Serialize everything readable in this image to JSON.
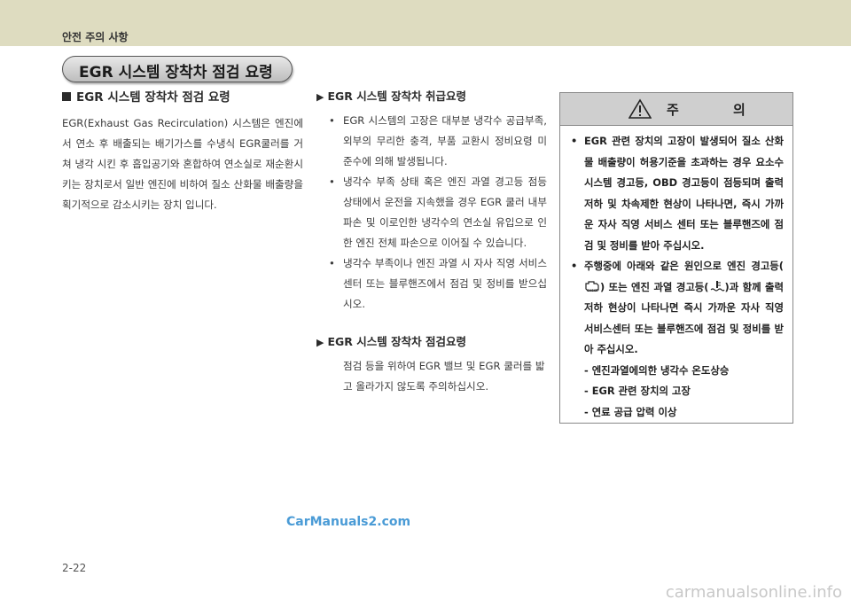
{
  "header": {
    "title": "안전 주의 사항"
  },
  "section_pill": "EGR 시스템 장착차 점검 요령",
  "col1": {
    "heading": "EGR 시스템 장착차 점검 요령",
    "body": "EGR(Exhaust Gas Recirculation) 시스템은 엔진에서 연소 후 배출되는 배기가스를 수냉식 EGR쿨러를 거쳐 냉각 시킨 후 흡입공기와 혼합하여 연소실로 재순환시키는 장치로서 일반 엔진에 비하여 질소 산화물 배출량을 획기적으로 감소시키는 장치 입니다."
  },
  "col2": {
    "handling_heading": "EGR 시스템 장착차 취급요령",
    "handling_items": [
      "EGR 시스템의 고장은 대부분 냉각수 공급부족, 외부의 무리한 충격, 부품 교환시 정비요령 미 준수에 의해 발생됩니다.",
      "냉각수 부족 상태 혹은 엔진 과열 경고등 점등 상태에서 운전을 지속했을 경우 EGR 쿨러 내부 파손 및 이로인한 냉각수의 연소실 유입으로 인한 엔진 전체 파손으로 이어질 수 있습니다.",
      "냉각수 부족이나 엔진 과열 시 자사 직영 서비스센터 또는 블루핸즈에서 점검 및 정비를 받으십시오."
    ],
    "inspect_heading": "EGR 시스템 장착차 점검요령",
    "inspect_text": "점검 등을 위하여 EGR 밸브 및 EGR 쿨러를 밟고 올라가지 않도록 주의하십시오."
  },
  "caution": {
    "title": "주 의",
    "item1": "EGR 관련 장치의 고장이 발생되어 질소 산화물 배출량이 허용기준을 초과하는 경우 요소수 시스템 경고등, OBD 경고등이 점등되며 출력저하 및 차속제한 현상이 나타나면, 즉시 가까운 자사 직영 서비스 센터 또는 블루핸즈에 점검 및 정비를 받아 주십시오.",
    "item2_a": "주행중에 아래와 같은 원인으로 엔진 경고등(",
    "item2_b": ") 또는 엔진 과열 경고등(",
    "item2_c": ")과 함께 출력저하 현상이 나타나면 즉시 가까운 자사 직영 서비스센터 또는 블루핸즈에 점검 및 정비를 받아 주십시오.",
    "causes": [
      "- 엔진과열에의한 냉각수 온도상승",
      "- EGR 관련 장치의 고장",
      "- 연료 공급 압력 이상"
    ]
  },
  "watermark": "CarManuals2.com",
  "page_number": "2-22",
  "footer_url": "carmanualsonline.info"
}
